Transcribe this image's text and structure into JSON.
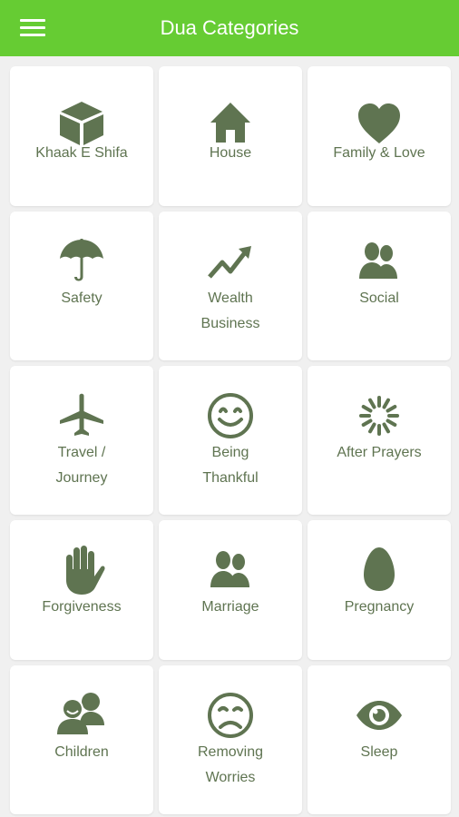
{
  "appbar": {
    "title": "Dua Categories",
    "menu_icon": "hamburger-menu-icon"
  },
  "theme": {
    "appbar": "#66cc33",
    "icon": "#5f7451",
    "card": "#ffffff",
    "background": "#f0f0f0"
  },
  "categories": [
    {
      "label": "Khaak E Shifa",
      "icon": "box-icon"
    },
    {
      "label": "House",
      "icon": "house-icon"
    },
    {
      "label": "Family & Love",
      "icon": "heart-icon"
    },
    {
      "label": "Safety",
      "icon": "umbrella-icon"
    },
    {
      "label": "Wealth\nBusiness",
      "icon": "trend-up-icon"
    },
    {
      "label": "Social",
      "icon": "users-icon"
    },
    {
      "label": "Travel /\nJourney",
      "icon": "airplane-icon"
    },
    {
      "label": "Being\nThankful",
      "icon": "smile-icon"
    },
    {
      "label": "After Prayers",
      "icon": "loading-spinner-icon"
    },
    {
      "label": "Forgiveness",
      "icon": "hand-icon"
    },
    {
      "label": "Marriage",
      "icon": "couple-icon"
    },
    {
      "label": "Pregnancy",
      "icon": "egg-icon"
    },
    {
      "label": "Children",
      "icon": "chat-users-icon"
    },
    {
      "label": "Removing\nWorries",
      "icon": "sad-face-icon"
    },
    {
      "label": "Sleep",
      "icon": "eye-icon"
    }
  ]
}
